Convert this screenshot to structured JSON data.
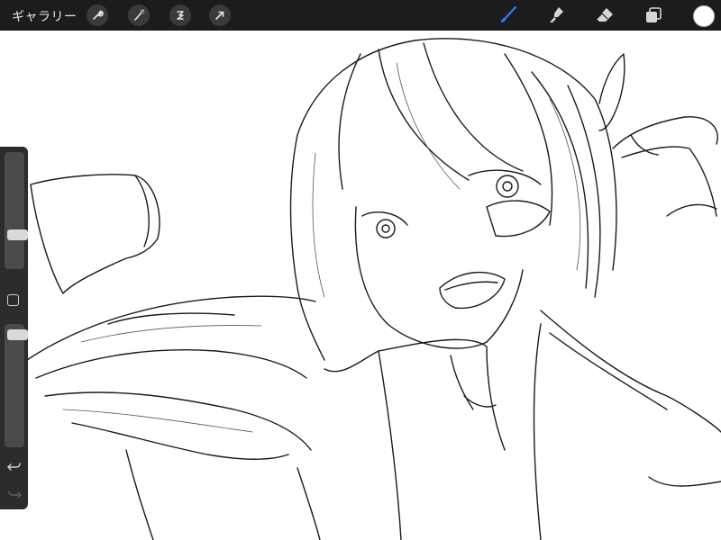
{
  "topbar": {
    "gallery_label": "ギャラリー",
    "left_tools": [
      "wrench-icon",
      "magic-wand-icon",
      "selection-icon",
      "transform-arrow-icon"
    ],
    "right_tools": [
      "brush-icon",
      "smudge-icon",
      "eraser-icon",
      "layers-icon"
    ],
    "active_tool": "brush-icon",
    "active_color": "#ffffff",
    "accent": "#2f7cf6"
  },
  "sidebar": {
    "brush_size_level": 0.27,
    "opacity_level": 0.95
  }
}
